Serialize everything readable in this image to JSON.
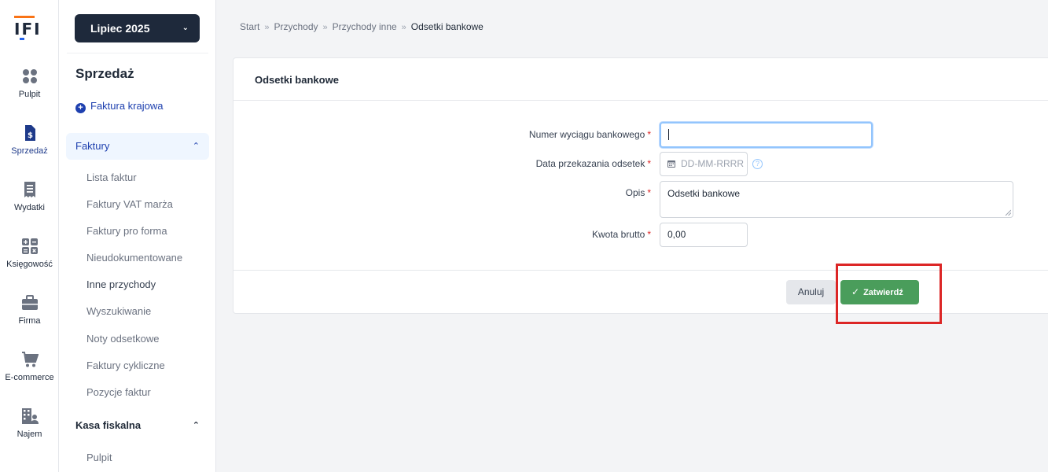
{
  "logo": {
    "text": "IFI"
  },
  "rail": [
    {
      "label": "Pulpit",
      "icon": "dashboard-icon"
    },
    {
      "label": "Sprzedaż",
      "icon": "invoice-dollar-icon"
    },
    {
      "label": "Wydatki",
      "icon": "receipt-icon"
    },
    {
      "label": "Księgowość",
      "icon": "calculator-icon"
    },
    {
      "label": "Firma",
      "icon": "briefcase-icon"
    },
    {
      "label": "E-commerce",
      "icon": "cart-icon"
    },
    {
      "label": "Najem",
      "icon": "building-user-icon"
    }
  ],
  "sidebar": {
    "month": "Lipiec 2025",
    "title": "Sprzedaż",
    "add_link": "Faktura krajowa",
    "groups": [
      {
        "label": "Faktury",
        "items": [
          "Lista faktur",
          "Faktury VAT marża",
          "Faktury pro forma",
          "Nieudokumentowane",
          "Inne przychody",
          "Wyszukiwanie",
          "Noty odsetkowe",
          "Faktury cykliczne",
          "Pozycje faktur"
        ]
      },
      {
        "label": "Kasa fiskalna",
        "items": [
          "Pulpit"
        ]
      }
    ]
  },
  "breadcrumb": [
    "Start",
    "Przychody",
    "Przychody inne",
    "Odsetki bankowe"
  ],
  "form": {
    "title": "Odsetki bankowe",
    "fields": {
      "statement": {
        "label": "Numer wyciągu bankowego",
        "value": ""
      },
      "date": {
        "label": "Data przekazania odsetek",
        "placeholder": "DD-MM-RRRR",
        "help": "?"
      },
      "desc": {
        "label": "Opis",
        "value": "Odsetki bankowe"
      },
      "amount": {
        "label": "Kwota brutto",
        "value": "0,00"
      }
    },
    "required_mark": "*",
    "cancel_label": "Anuluj",
    "submit_label": "Zatwierdź"
  },
  "colors": {
    "primary_dark": "#1e293b",
    "accent_blue": "#1e40af",
    "submit_green": "#4a9d5b",
    "highlight_red": "#dc2626"
  }
}
